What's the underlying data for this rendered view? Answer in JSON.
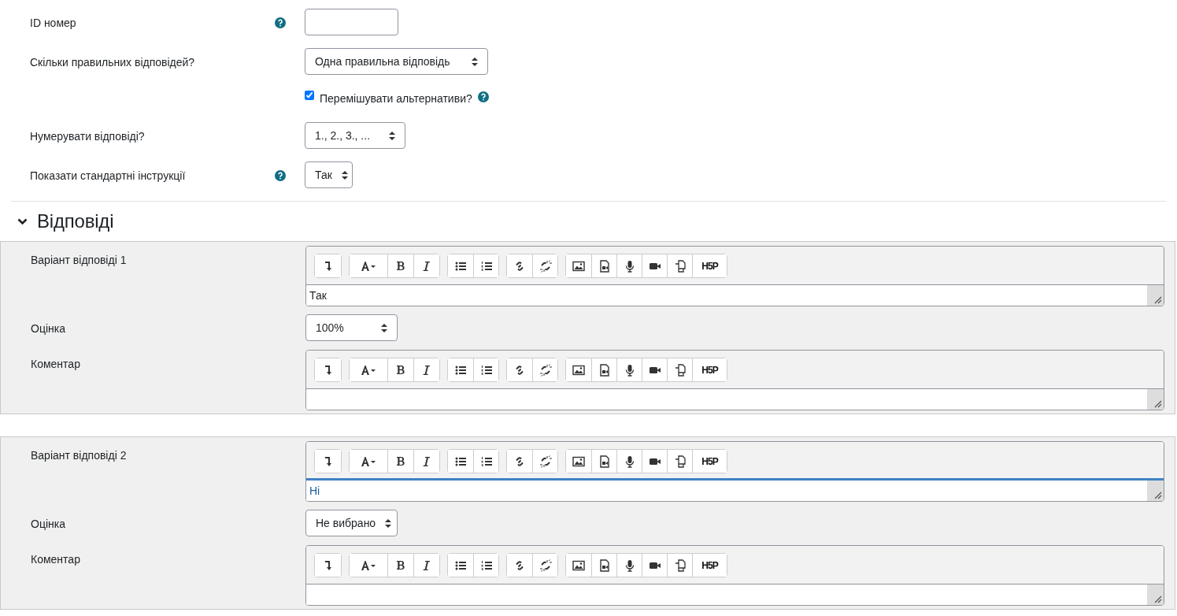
{
  "general_fields": [
    {
      "kind": "text",
      "label": "ID номер",
      "help": true
    },
    {
      "kind": "select",
      "label": "Скільки правильних відповідей?",
      "help": false,
      "value": "Одна правильна відповідь"
    },
    {
      "kind": "checkbox",
      "label": "Перемішувати альтернативи?",
      "help": true,
      "checked": true
    },
    {
      "kind": "select",
      "label": "Нумерувати відповіді?",
      "help": false,
      "value": "1., 2., 3., ..."
    },
    {
      "kind": "select",
      "label": "Показати стандартні інструкції",
      "help": true,
      "value": "Так"
    }
  ],
  "section": {
    "title": "Відповіді",
    "expanded": true
  },
  "answers": [
    {
      "answer_label": "Варіант відповіді 1",
      "answer_editor": {
        "content": "Так",
        "focused": false,
        "h5p_button": "H5P"
      },
      "grade_label": "Оцінка",
      "grade": "100%",
      "feedback_label": "Коментар",
      "feedback_editor": {
        "focused": false,
        "h5p_button": "H5P"
      }
    },
    {
      "answer_label": "Варіант відповіді 2",
      "answer_editor": {
        "content": "Ні",
        "focused": true,
        "h5p_button": "H5P"
      },
      "grade_label": "Оцінка",
      "grade": "Не вибрано",
      "feedback_label": "Коментар",
      "feedback_editor": {
        "focused": false,
        "h5p_button": "H5P"
      }
    }
  ]
}
